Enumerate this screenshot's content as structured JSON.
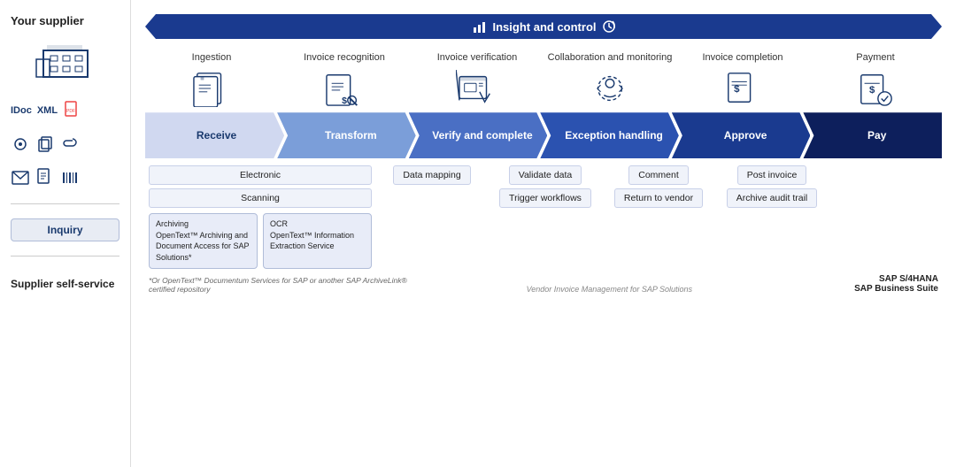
{
  "sidebar": {
    "supplier_title": "Your supplier",
    "idoc_label": "IDoc",
    "xml_label": "XML",
    "inquiry_label": "Inquiry",
    "self_service_label": "Supplier self-service"
  },
  "insight_bar": {
    "label": "Insight and control"
  },
  "stages": [
    {
      "id": "ingestion",
      "title": "Ingestion"
    },
    {
      "id": "invoice_recognition",
      "title": "Invoice recognition"
    },
    {
      "id": "invoice_verification",
      "title": "Invoice verification"
    },
    {
      "id": "collaboration",
      "title": "Collaboration and monitoring"
    },
    {
      "id": "invoice_completion",
      "title": "Invoice completion"
    },
    {
      "id": "payment",
      "title": "Payment"
    }
  ],
  "process_segments": [
    {
      "id": "receive",
      "label": "Receive",
      "style": "receive"
    },
    {
      "id": "transform",
      "label": "Transform",
      "style": "transform"
    },
    {
      "id": "verify",
      "label": "Verify and complete",
      "style": "verify"
    },
    {
      "id": "exception",
      "label": "Exception handling",
      "style": "exception"
    },
    {
      "id": "approve",
      "label": "Approve",
      "style": "approve"
    },
    {
      "id": "pay",
      "label": "Pay",
      "style": "pay"
    }
  ],
  "detail_rows": {
    "receive": {
      "items": [
        "Electronic",
        "Scanning"
      ],
      "archiving": {
        "title": "Archiving",
        "subtitle": "OpenText™ Archiving and Document Access for SAP Solutions*"
      },
      "ocr": {
        "title": "OCR",
        "subtitle": "OpenText™ Information Extraction Service"
      }
    },
    "transform": {
      "items": [
        "Data mapping"
      ]
    },
    "verify": {
      "items": [
        "Validate data",
        "Trigger workflows"
      ]
    },
    "exception": {
      "items": [
        "Comment",
        "Return to vendor"
      ]
    },
    "approve": {
      "items": [
        "Post invoice",
        "Archive audit trail"
      ]
    }
  },
  "footer": {
    "vim_label": "Vendor Invoice Management for SAP Solutions",
    "sap_label": "SAP S/4HANA\nSAP Business Suite",
    "footnote": "*Or OpenText™ Documentum Services for SAP or another SAP ArchiveLink® certified repository"
  }
}
